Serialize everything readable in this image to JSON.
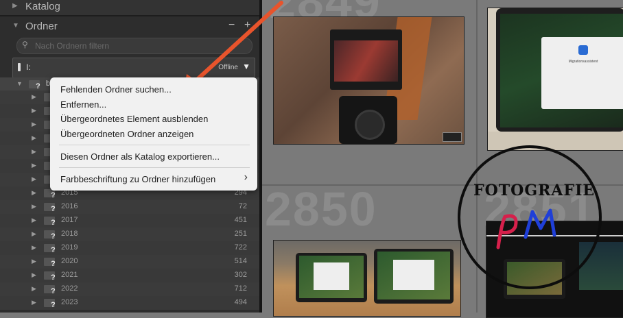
{
  "panel": {
    "catalog_label": "Katalog",
    "folders_label": "Ordner",
    "minus_label": "−",
    "plus_label": "+",
    "search_placeholder": "Nach Ordnern filtern",
    "volume_name": "I:",
    "volume_status": "Offline",
    "root_folder_letter": "b",
    "folders": [
      {
        "name": "",
        "count": ""
      },
      {
        "name": "",
        "count": ""
      },
      {
        "name": "",
        "count": ""
      },
      {
        "name": "",
        "count": ""
      },
      {
        "name": "",
        "count": ""
      },
      {
        "name": "",
        "count": ""
      },
      {
        "name": "",
        "count": ""
      },
      {
        "name": "2015",
        "count": "294"
      },
      {
        "name": "2016",
        "count": "72"
      },
      {
        "name": "2017",
        "count": "451"
      },
      {
        "name": "2018",
        "count": "251"
      },
      {
        "name": "2019",
        "count": "722"
      },
      {
        "name": "2020",
        "count": "514"
      },
      {
        "name": "2021",
        "count": "302"
      },
      {
        "name": "2022",
        "count": "712"
      },
      {
        "name": "2023",
        "count": "494"
      }
    ]
  },
  "context_menu": {
    "items": [
      "Fehlenden Ordner suchen...",
      "Entfernen...",
      "Übergeordnetes Element ausblenden",
      "Übergeordneten Ordner anzeigen",
      "Diesen Ordner als Katalog exportieren...",
      "Farbbeschriftung zu Ordner hinzufügen"
    ],
    "submenu_arrow": "›"
  },
  "grid": {
    "cell_numbers": [
      "2849",
      "2850",
      "2851"
    ],
    "installer_title": "Migrationsassistent"
  },
  "watermark": {
    "text_top": "FOTOGRAFIE",
    "initials": "PM"
  },
  "colors": {
    "annotation_arrow": "#e8542c",
    "panel_bg": "#2d2d2d",
    "menu_bg": "#f1f1f1"
  }
}
